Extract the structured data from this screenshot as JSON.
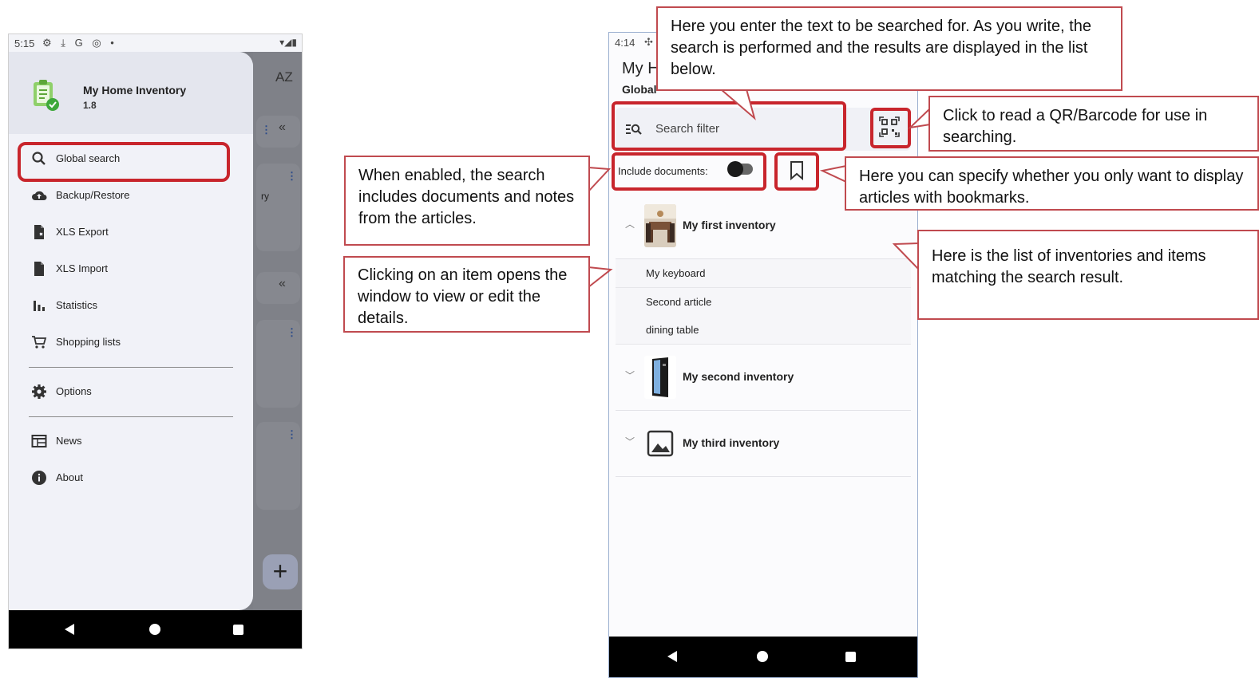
{
  "phone1": {
    "status": {
      "time": "5:15",
      "icons": "⚙ ⤓ G ◎ •"
    },
    "background_app": {
      "sort_label": "AZ",
      "chevron": "«",
      "dots": "⋮",
      "snippet": "ry",
      "fab": "+"
    },
    "drawer": {
      "app_name": "My Home Inventory",
      "version": "1.8",
      "items": [
        {
          "label": "Global search",
          "icon": "search-icon"
        },
        {
          "label": "Backup/Restore",
          "icon": "cloud-upload-icon"
        },
        {
          "label": "XLS Export",
          "icon": "file-export-icon"
        },
        {
          "label": "XLS Import",
          "icon": "file-import-icon"
        },
        {
          "label": "Statistics",
          "icon": "bar-chart-icon"
        },
        {
          "label": "Shopping lists",
          "icon": "cart-icon"
        },
        {
          "label": "Options",
          "icon": "gear-icon"
        },
        {
          "label": "News",
          "icon": "news-icon"
        },
        {
          "label": "About",
          "icon": "info-icon"
        }
      ]
    }
  },
  "phone2": {
    "status": {
      "time": "4:14"
    },
    "title": "My H",
    "subtitle": "Global",
    "search": {
      "placeholder": "Search filter"
    },
    "include_documents_label": "Include documents:",
    "inventories": [
      {
        "name": "My first inventory",
        "expanded": true,
        "items": [
          "My keyboard",
          "Second article",
          "dining table"
        ]
      },
      {
        "name": "My second inventory",
        "expanded": false
      },
      {
        "name": "My third inventory",
        "expanded": false
      }
    ]
  },
  "callouts": {
    "search_text": "Here you enter the text to be searched for. As you write, the search is performed and the results are displayed in the list below.",
    "qr": "Click to read a QR/Barcode for use in searching.",
    "include_docs": "When enabled, the search includes documents and notes from the articles.",
    "bookmarks": "Here you can specify whether you only want to display articles with bookmarks.",
    "click_item": "Clicking on an item opens the window to view or edit the details.",
    "list": "Here is the list of inventories and items matching the search result."
  },
  "colors": {
    "highlight_red": "#c8252c",
    "callout_border": "#c04a4f",
    "drawer_bg": "#f1f2f8"
  }
}
